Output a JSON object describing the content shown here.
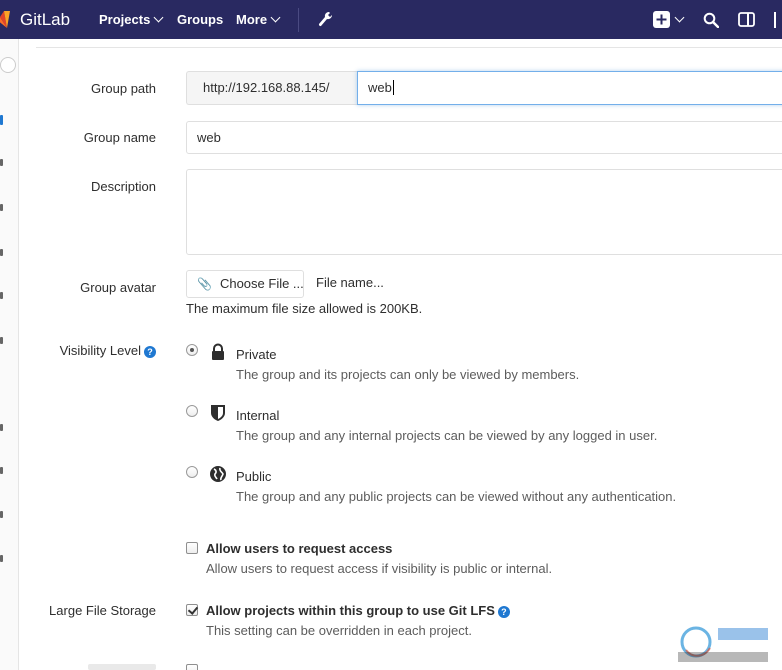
{
  "navbar": {
    "brand": "GitLab",
    "projects": "Projects",
    "groups": "Groups",
    "more": "More",
    "accent": "#292961"
  },
  "form": {
    "group_path": {
      "label": "Group path",
      "prefix": "http://192.168.88.145/",
      "value": "web"
    },
    "group_name": {
      "label": "Group name",
      "value": "web"
    },
    "description": {
      "label": "Description",
      "value": ""
    },
    "avatar": {
      "label": "Group avatar",
      "button": "Choose File ...",
      "file_name": "File name...",
      "hint": "The maximum file size allowed is 200KB."
    },
    "visibility": {
      "label": "Visibility Level",
      "selected": "Private",
      "options": [
        {
          "title": "Private",
          "icon": "lock-icon",
          "desc": "The group and its projects can only be viewed by members."
        },
        {
          "title": "Internal",
          "icon": "shield-icon",
          "desc": "The group and any internal projects can be viewed by any logged in user."
        },
        {
          "title": "Public",
          "icon": "globe-icon",
          "desc": "The group and any public projects can be viewed without any authentication."
        }
      ]
    },
    "request_access": {
      "checked": false,
      "title": "Allow users to request access",
      "desc": "Allow users to request access if visibility is public or internal."
    },
    "lfs": {
      "label": "Large File Storage",
      "checked": true,
      "title": "Allow projects within this group to use Git LFS",
      "desc": "This setting can be overridden in each project."
    }
  }
}
